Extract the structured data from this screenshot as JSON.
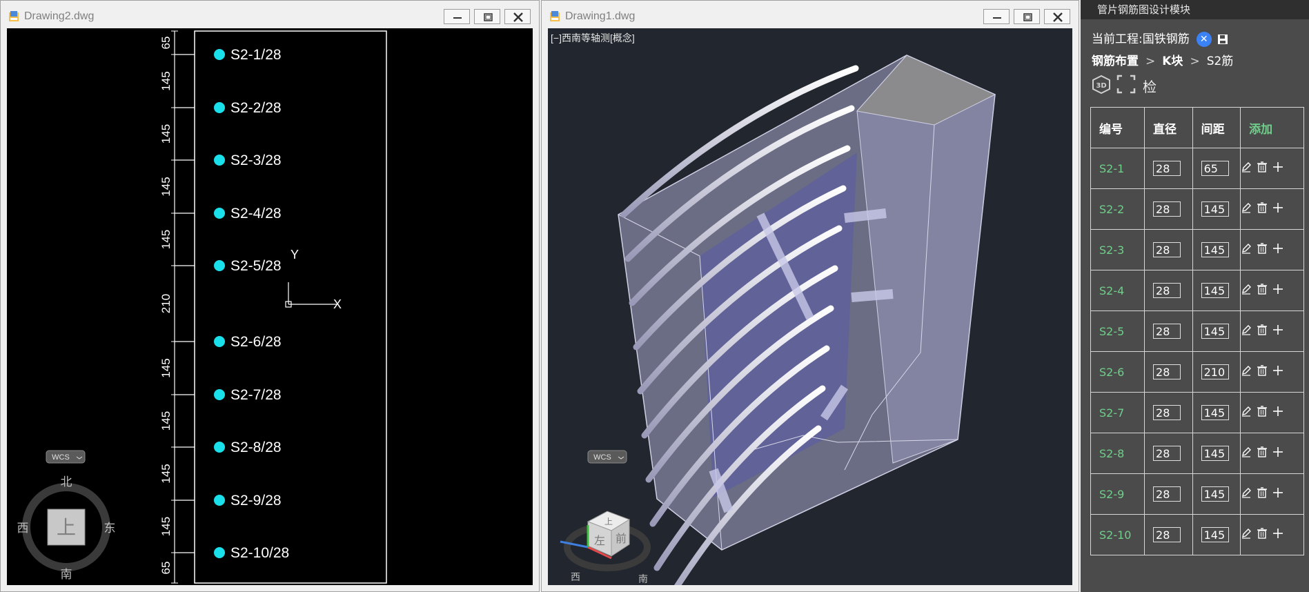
{
  "window1": {
    "title": "Drawing2.dwg"
  },
  "window2": {
    "title": "Drawing1.dwg",
    "viewport_label": "[−]西南等轴测[概念]"
  },
  "drawing": {
    "labels": [
      "S2-1/28",
      "S2-2/28",
      "S2-3/28",
      "S2-4/28",
      "S2-5/28",
      "S2-6/28",
      "S2-7/28",
      "S2-8/28",
      "S2-9/28",
      "S2-10/28"
    ],
    "dims": [
      "65",
      "145",
      "145",
      "145",
      "145",
      "210",
      "145",
      "145",
      "145",
      "145",
      "65"
    ],
    "axis_x": "X",
    "axis_y": "Y"
  },
  "navigation": {
    "wcs_label": "WCS",
    "north": "北",
    "south": "南",
    "east": "东",
    "west": "西",
    "top": "上",
    "cube_top": "上",
    "cube_front": "前",
    "cube_left": "左"
  },
  "panel": {
    "title": "管片钢筋图设计模块",
    "project_label": "当前工程:国铁钢筋",
    "close_glyph": "✕",
    "breadcrumb": [
      "钢筋布置",
      "K块",
      "S2筋"
    ],
    "breadcrumb_sep": ">",
    "check_label": "检",
    "columns": [
      "编号",
      "直径",
      "间距",
      "添加"
    ],
    "rows": [
      {
        "id": "S2-1",
        "diameter": "28",
        "spacing": "65"
      },
      {
        "id": "S2-2",
        "diameter": "28",
        "spacing": "145"
      },
      {
        "id": "S2-3",
        "diameter": "28",
        "spacing": "145"
      },
      {
        "id": "S2-4",
        "diameter": "28",
        "spacing": "145"
      },
      {
        "id": "S2-5",
        "diameter": "28",
        "spacing": "145"
      },
      {
        "id": "S2-6",
        "diameter": "28",
        "spacing": "210"
      },
      {
        "id": "S2-7",
        "diameter": "28",
        "spacing": "145"
      },
      {
        "id": "S2-8",
        "diameter": "28",
        "spacing": "145"
      },
      {
        "id": "S2-9",
        "diameter": "28",
        "spacing": "145"
      },
      {
        "id": "S2-10",
        "diameter": "28",
        "spacing": "145"
      }
    ]
  },
  "colors": {
    "rebar_marker": "#19e0ea",
    "drawing_line": "#ffffff",
    "accent_green": "#6fcf8a",
    "panel_bg": "#4b4b4b"
  }
}
